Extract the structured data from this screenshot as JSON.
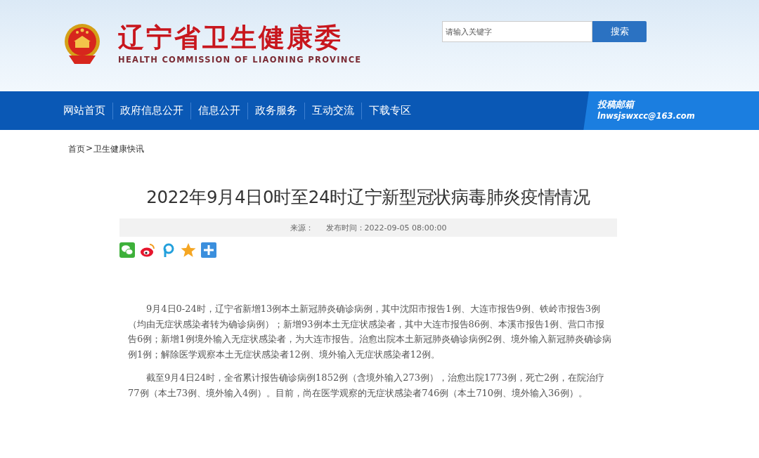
{
  "header": {
    "title": "辽宁省卫生健康委",
    "subtitle": "HEALTH COMMISSION OF LIAONING PROVINCE"
  },
  "search": {
    "placeholder": "请输入关键字",
    "button": "搜索"
  },
  "nav": {
    "items": [
      {
        "label": "网站首页"
      },
      {
        "label": "政府信息公开"
      },
      {
        "label": "信息公开"
      },
      {
        "label": "政务服务"
      },
      {
        "label": "互动交流"
      },
      {
        "label": "下载专区"
      }
    ],
    "mailbox": {
      "label": "投稿邮箱",
      "email": "lnwsjswxcc@163.com"
    }
  },
  "breadcrumb": [
    "首页",
    ">",
    "卫生健康快讯"
  ],
  "article": {
    "title": "2022年9月4日0时至24时辽宁新型冠状病毒肺炎疫情情况",
    "source_label": "来源：",
    "published": "发布时间：2022-09-05 08:00:00",
    "share_icons": [
      {
        "kind": "wechat"
      },
      {
        "kind": "weibo"
      },
      {
        "kind": "p"
      },
      {
        "kind": "star"
      },
      {
        "kind": "plus"
      }
    ],
    "paragraphs": [
      "9月4日0-24时，辽宁省新增13例本土新冠肺炎确诊病例，其中沈阳市报告1例、大连市报告9例、铁岭市报告3例（均由无症状感染者转为确诊病例）；新增93例本土无症状感染者，其中大连市报告86例、本溪市报告1例、营口市报告6例；新增1例境外输入无症状感染者，为大连市报告。治愈出院本土新冠肺炎确诊病例2例、境外输入新冠肺炎确诊病例1例；解除医学观察本土无症状感染者12例、境外输入无症状感染者12例。",
      "截至9月4日24时，全省累计报告确诊病例1852例（含境外输入273例），治愈出院1773例，死亡2例，在院治疗77例（本土73例、境外输入4例）。目前，尚在医学观察的无症状感染者746例（本土710例、境外输入36例）。"
    ]
  }
}
